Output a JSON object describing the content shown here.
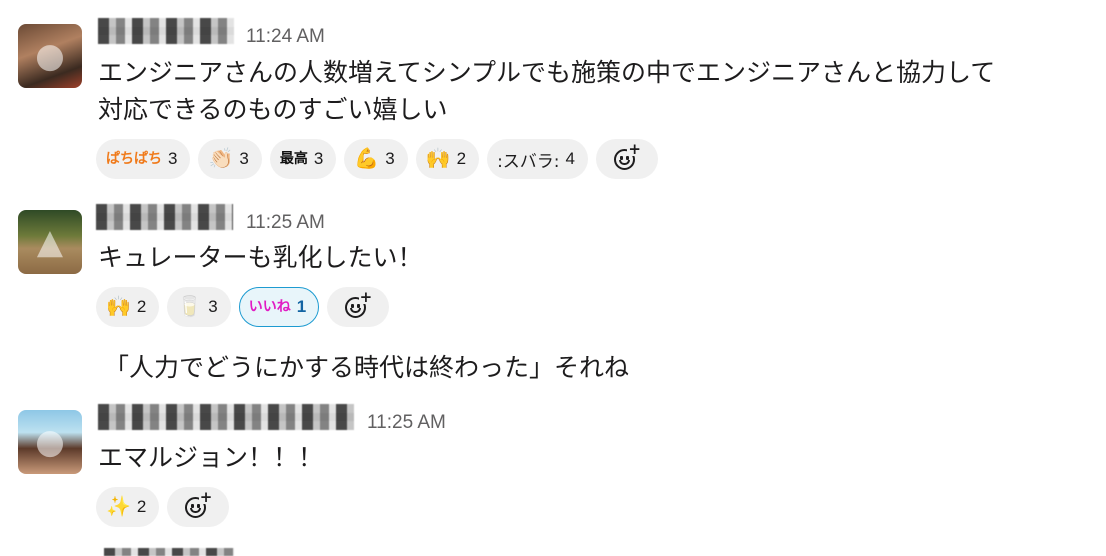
{
  "messages": [
    {
      "time": "11:24 AM",
      "lines": [
        "エンジニアさんの人数増えてシンプルでも施策の中でエンジニアさんと協力して",
        "対応できるのものすごい嬉しい"
      ],
      "reactions": [
        {
          "emoji": "ぱちぱち",
          "emoji_name": "pachipachi-text-emoji",
          "count": "3"
        },
        {
          "emoji": "👏🏻",
          "emoji_name": "clapping-hands-icon",
          "count": "3"
        },
        {
          "emoji": "最高",
          "emoji_name": "saikou-text-emoji",
          "count": "3"
        },
        {
          "emoji": "💪",
          "emoji_name": "flexed-biceps-icon",
          "count": "3"
        },
        {
          "emoji": "🙌",
          "emoji_name": "raising-hands-icon",
          "count": "2"
        },
        {
          "emoji": ":スバラ:",
          "emoji_name": "subara-text-emoji",
          "count": "4"
        }
      ]
    },
    {
      "time": "11:25 AM",
      "lines": [
        "キュレーターも乳化したい！"
      ],
      "reactions": [
        {
          "emoji": "🙌",
          "emoji_name": "raising-hands-icon",
          "count": "2"
        },
        {
          "emoji": "🥛",
          "emoji_name": "glass-of-milk-icon",
          "count": "3"
        },
        {
          "emoji": "いいね",
          "emoji_name": "iine-text-emoji",
          "count": "1",
          "active": true
        }
      ],
      "continuation": "「人力でどうにかする時代は終わった」それね"
    },
    {
      "time": "11:25 AM",
      "lines": [
        "エマルジョン！！！"
      ],
      "reactions": [
        {
          "emoji": "✨",
          "emoji_name": "sparkles-icon",
          "count": "2"
        }
      ]
    }
  ],
  "colors": {
    "text": "#1d1c1d",
    "timestamp": "#616061",
    "reaction_bg": "#f0f0f0",
    "reaction_active_border": "#1d9bd1",
    "reaction_active_text": "#1264a3"
  }
}
